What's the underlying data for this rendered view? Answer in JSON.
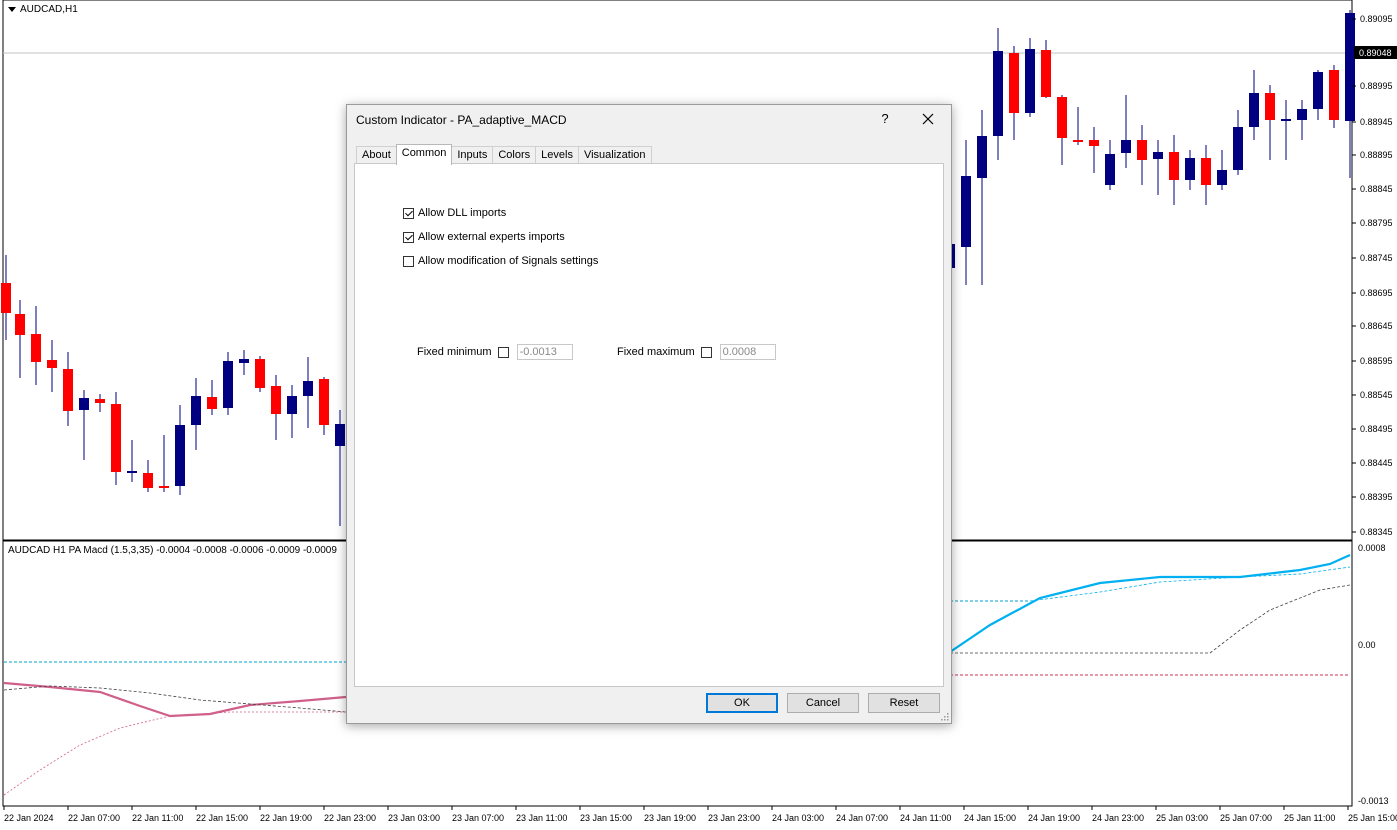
{
  "chart": {
    "symbol": "AUDCAD,H1",
    "indicator_title": "AUDCAD H1 PA Macd (1.5,3,35) -0.0004 -0.0008 -0.0006 -0.0009 -0.0009",
    "current_price": "0.89048",
    "price_labels": [
      "0.89095",
      "0.88995",
      "0.88945",
      "0.88895",
      "0.88845",
      "0.88795",
      "0.88745",
      "0.88695",
      "0.88645",
      "0.88595",
      "0.88545",
      "0.88495",
      "0.88445",
      "0.88395",
      "0.88345"
    ],
    "indicator_labels": [
      "0.0008",
      "0.00",
      "-0.0013"
    ],
    "time_labels": [
      "22 Jan 2024",
      "22 Jan 07:00",
      "22 Jan 11:00",
      "22 Jan 15:00",
      "22 Jan 19:00",
      "22 Jan 23:00",
      "23 Jan 03:00",
      "23 Jan 07:00",
      "23 Jan 11:00",
      "23 Jan 15:00",
      "23 Jan 19:00",
      "23 Jan 23:00",
      "24 Jan 03:00",
      "24 Jan 07:00",
      "24 Jan 11:00",
      "24 Jan 15:00",
      "24 Jan 19:00",
      "24 Jan 23:00",
      "25 Jan 03:00",
      "25 Jan 07:00",
      "25 Jan 11:00",
      "25 Jan 15:00"
    ],
    "colors": {
      "bull": "#000080",
      "bear": "#ff0000",
      "macd_up": "#00b0f0",
      "macd_down": "#d0608a",
      "signal": "#404040",
      "level_up": "#00a0d0",
      "level_down": "#d03050"
    }
  },
  "dialog": {
    "title": "Custom Indicator - PA_adaptive_MACD",
    "help": "?",
    "tabs": [
      "About",
      "Common",
      "Inputs",
      "Colors",
      "Levels",
      "Visualization"
    ],
    "active_tab": "Common",
    "checkboxes": [
      {
        "label": "Allow DLL imports",
        "checked": true
      },
      {
        "label": "Allow external experts imports",
        "checked": true
      },
      {
        "label": "Allow modification of Signals settings",
        "checked": false
      }
    ],
    "fixed_minimum": {
      "label": "Fixed minimum",
      "checked": false,
      "value": "-0.0013"
    },
    "fixed_maximum": {
      "label": "Fixed maximum",
      "checked": false,
      "value": "0.0008"
    },
    "buttons": {
      "ok": "OK",
      "cancel": "Cancel",
      "reset": "Reset"
    }
  }
}
